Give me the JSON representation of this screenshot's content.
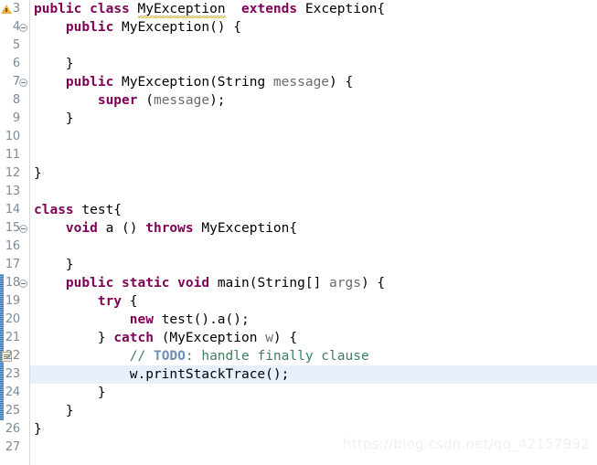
{
  "editor": {
    "name": "java-source-editor",
    "first_line_number": 3,
    "line_height": 20,
    "current_line": 23,
    "colors": {
      "background": "#ffffff",
      "keyword": "#7f0055",
      "comment": "#3f7f5f",
      "todo_tag": "#6a8fb5",
      "parameter": "#6a6a6a",
      "line_number": "#7b8a99",
      "current_line_highlight": "#e8f0fe",
      "change_bar": "#3f7fc4",
      "warning_squiggle": "#d7a92b"
    },
    "lines": [
      {
        "number": 3,
        "fold": false,
        "marker": "warning-icon",
        "change": false,
        "current": false,
        "text": "public class MyException  extends Exception{",
        "tokens": [
          {
            "t": "public",
            "c": "kw"
          },
          {
            "t": " ",
            "c": "id"
          },
          {
            "t": "class",
            "c": "kw"
          },
          {
            "t": " ",
            "c": "id"
          },
          {
            "t": "MyException",
            "c": "id",
            "squiggle": true
          },
          {
            "t": "  ",
            "c": "id"
          },
          {
            "t": "extends",
            "c": "kw"
          },
          {
            "t": " Exception{",
            "c": "id"
          }
        ]
      },
      {
        "number": 4,
        "fold": true,
        "marker": null,
        "change": false,
        "current": false,
        "text": "    public MyException() {",
        "tokens": [
          {
            "t": "    ",
            "c": "id"
          },
          {
            "t": "public",
            "c": "kw"
          },
          {
            "t": " MyException() {",
            "c": "id"
          }
        ]
      },
      {
        "number": 5,
        "fold": false,
        "marker": null,
        "change": false,
        "current": false,
        "text": "",
        "tokens": []
      },
      {
        "number": 6,
        "fold": false,
        "marker": null,
        "change": false,
        "current": false,
        "text": "    }",
        "tokens": [
          {
            "t": "    }",
            "c": "id"
          }
        ]
      },
      {
        "number": 7,
        "fold": true,
        "marker": null,
        "change": false,
        "current": false,
        "text": "    public MyException(String message) {",
        "tokens": [
          {
            "t": "    ",
            "c": "id"
          },
          {
            "t": "public",
            "c": "kw"
          },
          {
            "t": " MyException(String ",
            "c": "id"
          },
          {
            "t": "message",
            "c": "par"
          },
          {
            "t": ") {",
            "c": "id"
          }
        ]
      },
      {
        "number": 8,
        "fold": false,
        "marker": null,
        "change": false,
        "current": false,
        "text": "        super (message);",
        "tokens": [
          {
            "t": "        ",
            "c": "id"
          },
          {
            "t": "super",
            "c": "kw"
          },
          {
            "t": " (",
            "c": "id"
          },
          {
            "t": "message",
            "c": "par"
          },
          {
            "t": ");",
            "c": "id"
          }
        ]
      },
      {
        "number": 9,
        "fold": false,
        "marker": null,
        "change": false,
        "current": false,
        "text": "    }",
        "tokens": [
          {
            "t": "    }",
            "c": "id"
          }
        ]
      },
      {
        "number": 10,
        "fold": false,
        "marker": null,
        "change": false,
        "current": false,
        "text": "",
        "tokens": []
      },
      {
        "number": 11,
        "fold": false,
        "marker": null,
        "change": false,
        "current": false,
        "text": "",
        "tokens": []
      },
      {
        "number": 12,
        "fold": false,
        "marker": null,
        "change": false,
        "current": false,
        "text": "}",
        "tokens": [
          {
            "t": "}",
            "c": "id"
          }
        ]
      },
      {
        "number": 13,
        "fold": false,
        "marker": null,
        "change": false,
        "current": false,
        "text": "",
        "tokens": []
      },
      {
        "number": 14,
        "fold": false,
        "marker": null,
        "change": false,
        "current": false,
        "text": "class test{",
        "tokens": [
          {
            "t": "class",
            "c": "kw"
          },
          {
            "t": " test{",
            "c": "id"
          }
        ]
      },
      {
        "number": 15,
        "fold": true,
        "marker": null,
        "change": false,
        "current": false,
        "text": "    void a () throws MyException{",
        "tokens": [
          {
            "t": "    ",
            "c": "id"
          },
          {
            "t": "void",
            "c": "kw"
          },
          {
            "t": " a () ",
            "c": "id"
          },
          {
            "t": "throws",
            "c": "kw"
          },
          {
            "t": " MyException{",
            "c": "id"
          }
        ]
      },
      {
        "number": 16,
        "fold": false,
        "marker": null,
        "change": false,
        "current": false,
        "text": "",
        "tokens": []
      },
      {
        "number": 17,
        "fold": false,
        "marker": null,
        "change": false,
        "current": false,
        "text": "    }",
        "tokens": [
          {
            "t": "    }",
            "c": "id"
          }
        ]
      },
      {
        "number": 18,
        "fold": true,
        "marker": null,
        "change": true,
        "current": false,
        "text": "    public static void main(String[] args) {",
        "tokens": [
          {
            "t": "    ",
            "c": "id"
          },
          {
            "t": "public",
            "c": "kw"
          },
          {
            "t": " ",
            "c": "id"
          },
          {
            "t": "static",
            "c": "kw"
          },
          {
            "t": " ",
            "c": "id"
          },
          {
            "t": "void",
            "c": "kw"
          },
          {
            "t": " main(String[] ",
            "c": "id"
          },
          {
            "t": "args",
            "c": "par"
          },
          {
            "t": ") {",
            "c": "id"
          }
        ]
      },
      {
        "number": 19,
        "fold": false,
        "marker": null,
        "change": true,
        "current": false,
        "text": "        try {",
        "tokens": [
          {
            "t": "        ",
            "c": "id"
          },
          {
            "t": "try",
            "c": "kw"
          },
          {
            "t": " {",
            "c": "id"
          }
        ]
      },
      {
        "number": 20,
        "fold": false,
        "marker": null,
        "change": true,
        "current": false,
        "text": "            new test().a();",
        "tokens": [
          {
            "t": "            ",
            "c": "id"
          },
          {
            "t": "new",
            "c": "kw"
          },
          {
            "t": " test().a();",
            "c": "id"
          }
        ]
      },
      {
        "number": 21,
        "fold": false,
        "marker": null,
        "change": true,
        "current": false,
        "text": "        } catch (MyException w) {",
        "tokens": [
          {
            "t": "        } ",
            "c": "id"
          },
          {
            "t": "catch",
            "c": "kw"
          },
          {
            "t": " (MyException ",
            "c": "id"
          },
          {
            "t": "w",
            "c": "par"
          },
          {
            "t": ") {",
            "c": "id"
          }
        ]
      },
      {
        "number": 22,
        "fold": false,
        "marker": "todo-icon",
        "change": true,
        "current": false,
        "text": "            // TODO: handle finally clause",
        "tokens": [
          {
            "t": "            ",
            "c": "id"
          },
          {
            "t": "// ",
            "c": "cmt"
          },
          {
            "t": "TODO",
            "c": "todo"
          },
          {
            "t": ": handle finally clause",
            "c": "cmt"
          }
        ]
      },
      {
        "number": 23,
        "fold": false,
        "marker": null,
        "change": true,
        "current": true,
        "text": "            w.printStackTrace();",
        "tokens": [
          {
            "t": "            w.printStackTrace();",
            "c": "id"
          }
        ]
      },
      {
        "number": 24,
        "fold": false,
        "marker": null,
        "change": true,
        "current": false,
        "text": "        }",
        "tokens": [
          {
            "t": "        }",
            "c": "id"
          }
        ]
      },
      {
        "number": 25,
        "fold": false,
        "marker": null,
        "change": true,
        "current": false,
        "text": "    }",
        "tokens": [
          {
            "t": "    }",
            "c": "id"
          }
        ]
      },
      {
        "number": 26,
        "fold": false,
        "marker": null,
        "change": false,
        "current": false,
        "text": "}",
        "tokens": [
          {
            "t": "}",
            "c": "id"
          }
        ]
      },
      {
        "number": 27,
        "fold": false,
        "marker": null,
        "change": false,
        "current": false,
        "text": "",
        "tokens": []
      }
    ]
  },
  "watermark": {
    "text": "https://blog.csdn.net/qq_42157992"
  }
}
